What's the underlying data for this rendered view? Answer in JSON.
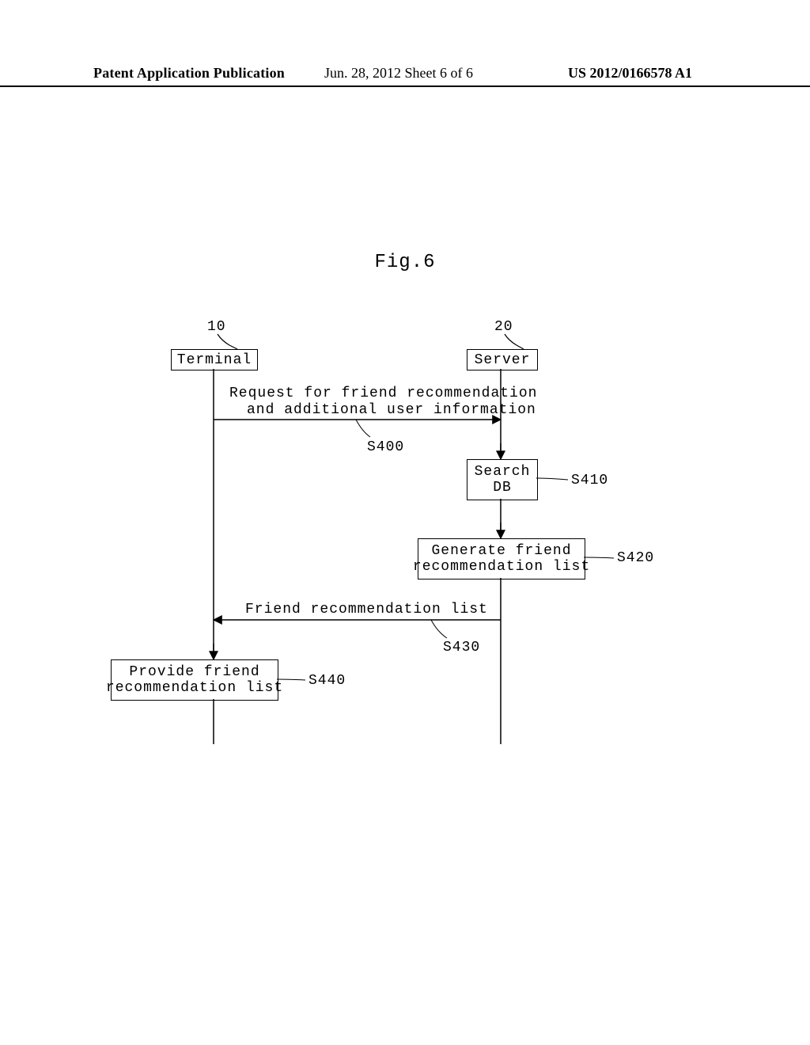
{
  "header": {
    "left": "Patent Application Publication",
    "center": "Jun. 28, 2012  Sheet 6 of 6",
    "right": "US 2012/0166578 A1"
  },
  "figure_title": "Fig.6",
  "terminal": {
    "ref": "10",
    "label": "Terminal"
  },
  "server": {
    "ref": "20",
    "label": "Server"
  },
  "messages": {
    "s400": {
      "line1": "Request for friend recommendation",
      "line2": "and additional user information",
      "ref": "S400"
    },
    "s430": {
      "text": "Friend recommendation list",
      "ref": "S430"
    }
  },
  "steps": {
    "s410": {
      "text": "Search\nDB",
      "ref": "S410"
    },
    "s420": {
      "text": "Generate friend\nrecommendation list",
      "ref": "S420"
    },
    "s440": {
      "text": "Provide friend\nrecommendation list",
      "ref": "S440"
    }
  }
}
